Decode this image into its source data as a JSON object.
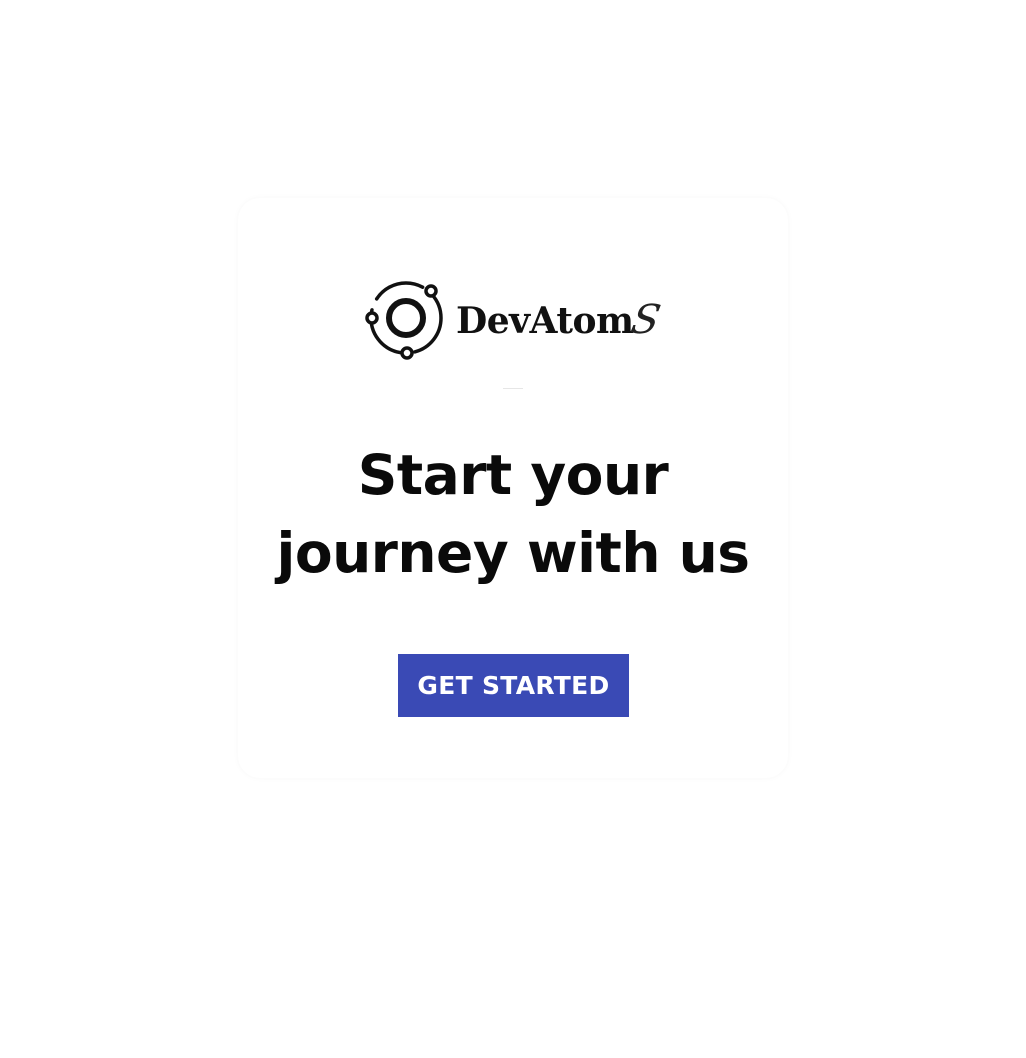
{
  "brand": {
    "name": "DevAtom",
    "suffix": "S",
    "logo_icon": "orbit-atom-icon"
  },
  "hero": {
    "line1": "Start your",
    "line2": "journey with us"
  },
  "cta": {
    "label": "GET STARTED"
  },
  "colors": {
    "background": "#ffffff",
    "card": "#ffffff",
    "button": "#3a4ab5",
    "button_text": "#ffffff",
    "headline": "#0a0a0a"
  }
}
